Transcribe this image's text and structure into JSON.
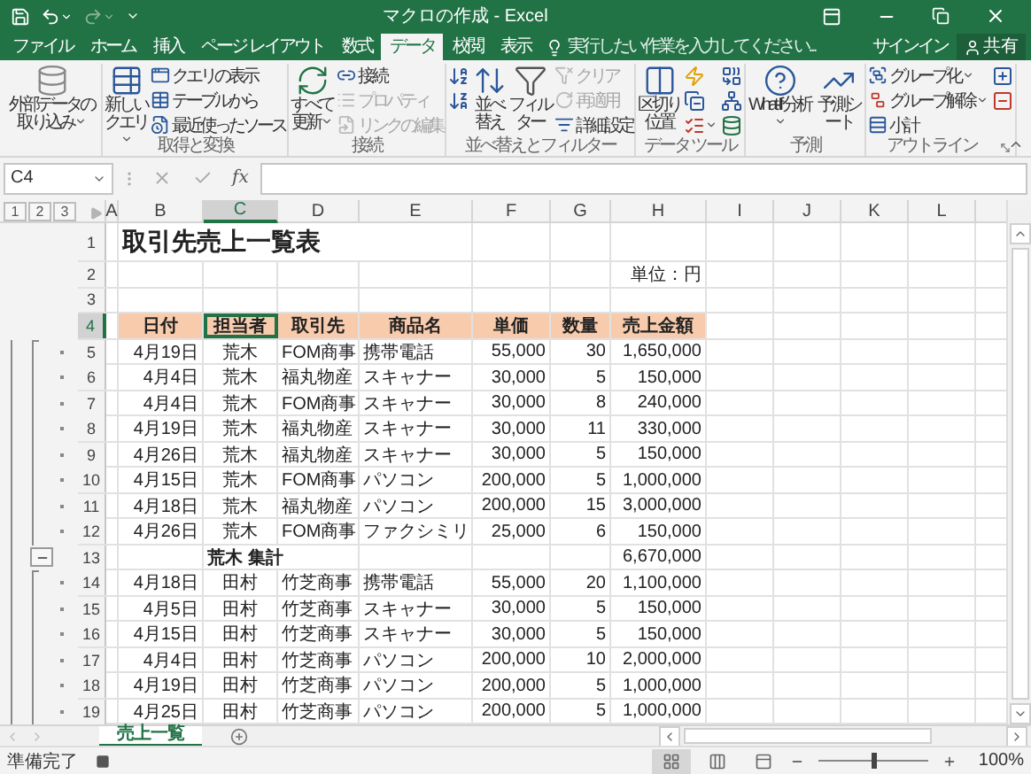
{
  "title_bar": {
    "title": "マクロの作成 - Excel"
  },
  "ribbon_tabs": [
    {
      "label": "ファイル",
      "selected": false
    },
    {
      "label": "ホーム",
      "selected": false
    },
    {
      "label": "挿入",
      "selected": false
    },
    {
      "label": "ページ レイアウト",
      "selected": false
    },
    {
      "label": "数式",
      "selected": false
    },
    {
      "label": "データ",
      "selected": true
    },
    {
      "label": "校閲",
      "selected": false
    },
    {
      "label": "表示",
      "selected": false
    }
  ],
  "tell_me": {
    "placeholder": "実行したい作業を入力してください..."
  },
  "account": {
    "sign_in": "サインイン",
    "share": "共有"
  },
  "ribbon_groups": [
    {
      "commands": [
        {
          "kind": "large",
          "label": "外部データの取り込み",
          "dropdown": true
        }
      ]
    },
    {
      "label": "取得と変換",
      "commands": [
        {
          "kind": "large",
          "label": "新しいクエリ",
          "dropdown": true
        },
        {
          "kind": "small",
          "label": "クエリの表示"
        },
        {
          "kind": "small",
          "label": "テーブルから"
        },
        {
          "kind": "small",
          "label": "最近使ったソース"
        }
      ]
    },
    {
      "label": "接続",
      "commands": [
        {
          "kind": "large",
          "label": "すべて更新",
          "dropdown": true
        },
        {
          "kind": "small",
          "label": "接続"
        },
        {
          "kind": "small",
          "label": "プロパティ",
          "disabled": true
        },
        {
          "kind": "small",
          "label": "リンクの編集",
          "disabled": true
        }
      ]
    },
    {
      "label": "並べ替えとフィルター",
      "commands": [
        {
          "kind": "icon"
        },
        {
          "kind": "icon"
        },
        {
          "kind": "large",
          "label": "並べ替え"
        },
        {
          "kind": "large",
          "label": "フィルター"
        },
        {
          "kind": "small",
          "label": "クリア",
          "disabled": true
        },
        {
          "kind": "small",
          "label": "再適用",
          "disabled": true
        },
        {
          "kind": "small",
          "label": "詳細設定"
        }
      ]
    },
    {
      "label": "データ ツール",
      "commands": [
        {
          "kind": "large",
          "label": "区切り位置"
        },
        {
          "kind": "icon"
        },
        {
          "kind": "icon"
        },
        {
          "kind": "icon",
          "dropdown": true
        },
        {
          "kind": "icon"
        },
        {
          "kind": "icon"
        },
        {
          "kind": "icon"
        }
      ]
    },
    {
      "label": "予測",
      "commands": [
        {
          "kind": "large",
          "label": "What-If 分析",
          "dropdown": true
        },
        {
          "kind": "large",
          "label": "予測シート"
        }
      ]
    },
    {
      "label": "アウトライン",
      "launcher": true,
      "commands": [
        {
          "kind": "small",
          "label": "グループ化",
          "dropdown": true
        },
        {
          "kind": "small",
          "label": "グループ解除",
          "dropdown": true
        },
        {
          "kind": "small",
          "label": "小計"
        },
        {
          "kind": "icon"
        },
        {
          "kind": "icon"
        }
      ]
    }
  ],
  "formula_bar": {
    "name_box": "C4",
    "function_label": "fx"
  },
  "outline_levels": [
    "1",
    "2",
    "3"
  ],
  "columns": [
    {
      "label": "A",
      "selected": false
    },
    {
      "label": "B",
      "selected": false
    },
    {
      "label": "C",
      "selected": true
    },
    {
      "label": "D",
      "selected": false
    },
    {
      "label": "E",
      "selected": false
    },
    {
      "label": "F",
      "selected": false
    },
    {
      "label": "G",
      "selected": false
    },
    {
      "label": "H",
      "selected": false
    },
    {
      "label": "I",
      "selected": false
    },
    {
      "label": "J",
      "selected": false
    },
    {
      "label": "K",
      "selected": false
    },
    {
      "label": "L",
      "selected": false
    }
  ],
  "rows": [
    {
      "number": "1",
      "kind": "title",
      "selected": false,
      "cells": {
        "B": "取引先売上一覧表"
      }
    },
    {
      "number": "2",
      "kind": "note",
      "selected": false,
      "cells": {
        "H": "単位：円"
      }
    },
    {
      "number": "3",
      "kind": "blank",
      "selected": false,
      "cells": {}
    },
    {
      "number": "4",
      "kind": "header",
      "selected": true,
      "cells": {
        "B": "日付",
        "C": "担当者",
        "D": "取引先",
        "E": "商品名",
        "F": "単価",
        "G": "数量",
        "H": "売上金額"
      }
    },
    {
      "number": "5",
      "kind": "data",
      "selected": false,
      "outline_detail": true,
      "cells": {
        "B": "4月19日",
        "C": "荒木",
        "D": "FOM商事",
        "E": "携帯電話",
        "F": "55,000",
        "G": "30",
        "H": "1,650,000"
      }
    },
    {
      "number": "6",
      "kind": "data",
      "selected": false,
      "outline_detail": true,
      "cells": {
        "B": "4月4日",
        "C": "荒木",
        "D": "福丸物産",
        "E": "スキャナー",
        "F": "30,000",
        "G": "5",
        "H": "150,000"
      }
    },
    {
      "number": "7",
      "kind": "data",
      "selected": false,
      "outline_detail": true,
      "cells": {
        "B": "4月4日",
        "C": "荒木",
        "D": "FOM商事",
        "E": "スキャナー",
        "F": "30,000",
        "G": "8",
        "H": "240,000"
      }
    },
    {
      "number": "8",
      "kind": "data",
      "selected": false,
      "outline_detail": true,
      "cells": {
        "B": "4月19日",
        "C": "荒木",
        "D": "福丸物産",
        "E": "スキャナー",
        "F": "30,000",
        "G": "11",
        "H": "330,000"
      }
    },
    {
      "number": "9",
      "kind": "data",
      "selected": false,
      "outline_detail": true,
      "cells": {
        "B": "4月26日",
        "C": "荒木",
        "D": "福丸物産",
        "E": "スキャナー",
        "F": "30,000",
        "G": "5",
        "H": "150,000"
      }
    },
    {
      "number": "10",
      "kind": "data",
      "selected": false,
      "outline_detail": true,
      "cells": {
        "B": "4月15日",
        "C": "荒木",
        "D": "FOM商事",
        "E": "パソコン",
        "F": "200,000",
        "G": "5",
        "H": "1,000,000"
      }
    },
    {
      "number": "11",
      "kind": "data",
      "selected": false,
      "outline_detail": true,
      "cells": {
        "B": "4月18日",
        "C": "荒木",
        "D": "福丸物産",
        "E": "パソコン",
        "F": "200,000",
        "G": "15",
        "H": "3,000,000"
      }
    },
    {
      "number": "12",
      "kind": "data",
      "selected": false,
      "outline_detail": true,
      "cells": {
        "B": "4月26日",
        "C": "荒木",
        "D": "FOM商事",
        "E": "ファクシミリ",
        "F": "25,000",
        "G": "6",
        "H": "150,000"
      }
    },
    {
      "number": "13",
      "kind": "subtotal",
      "selected": false,
      "outline_collapse": true,
      "cells": {
        "C": "荒木 集計",
        "H": "6,670,000"
      }
    },
    {
      "number": "14",
      "kind": "data",
      "selected": false,
      "outline_detail": true,
      "cells": {
        "B": "4月18日",
        "C": "田村",
        "D": "竹芝商事",
        "E": "携帯電話",
        "F": "55,000",
        "G": "20",
        "H": "1,100,000"
      }
    },
    {
      "number": "15",
      "kind": "data",
      "selected": false,
      "outline_detail": true,
      "cells": {
        "B": "4月5日",
        "C": "田村",
        "D": "竹芝商事",
        "E": "スキャナー",
        "F": "30,000",
        "G": "5",
        "H": "150,000"
      }
    },
    {
      "number": "16",
      "kind": "data",
      "selected": false,
      "outline_detail": true,
      "cells": {
        "B": "4月15日",
        "C": "田村",
        "D": "竹芝商事",
        "E": "スキャナー",
        "F": "30,000",
        "G": "5",
        "H": "150,000"
      }
    },
    {
      "number": "17",
      "kind": "data",
      "selected": false,
      "outline_detail": true,
      "cells": {
        "B": "4月4日",
        "C": "田村",
        "D": "竹芝商事",
        "E": "パソコン",
        "F": "200,000",
        "G": "10",
        "H": "2,000,000"
      }
    },
    {
      "number": "18",
      "kind": "data",
      "selected": false,
      "outline_detail": true,
      "cells": {
        "B": "4月19日",
        "C": "田村",
        "D": "竹芝商事",
        "E": "パソコン",
        "F": "200,000",
        "G": "5",
        "H": "1,000,000"
      }
    },
    {
      "number": "19",
      "kind": "data",
      "selected": false,
      "outline_detail": true,
      "cells": {
        "B": "4月25日",
        "C": "田村",
        "D": "竹芝商事",
        "E": "パソコン",
        "F": "200,000",
        "G": "5",
        "H": "1,000,000"
      }
    }
  ],
  "sheet_tabs": [
    {
      "label": "売上一覧",
      "selected": true
    }
  ],
  "status_bar": {
    "status": "準備完了",
    "views": [
      {
        "selected": true
      },
      {
        "selected": false
      },
      {
        "selected": false
      }
    ],
    "zoom": {
      "level": 0.5,
      "reading": "100%"
    }
  }
}
